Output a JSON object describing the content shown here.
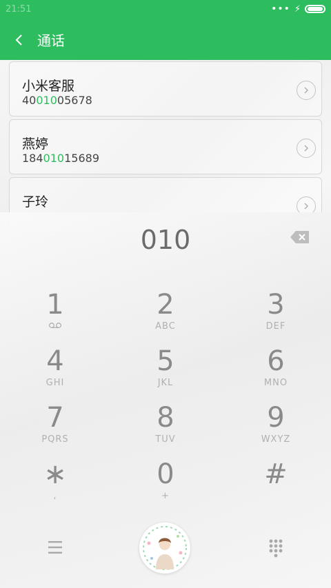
{
  "status_bar": {
    "time": "21:51",
    "dots": "•••",
    "bolt": "⚡"
  },
  "app_bar": {
    "title": "通话"
  },
  "contacts": [
    {
      "name": "小米客服",
      "number_prefix": "40",
      "number_match": "010",
      "number_suffix": "05678"
    },
    {
      "name": "燕婷",
      "number_prefix": "184",
      "number_match": "010",
      "number_suffix": "15689"
    },
    {
      "name": "子玲",
      "number_prefix": "",
      "number_match": "",
      "number_suffix": ""
    }
  ],
  "dialpad": {
    "typed": "010",
    "keys": [
      {
        "digit": "1",
        "sub": ""
      },
      {
        "digit": "2",
        "sub": "ABC"
      },
      {
        "digit": "3",
        "sub": "DEF"
      },
      {
        "digit": "4",
        "sub": "GHI"
      },
      {
        "digit": "5",
        "sub": "JKL"
      },
      {
        "digit": "6",
        "sub": "MNO"
      },
      {
        "digit": "7",
        "sub": "PQRS"
      },
      {
        "digit": "8",
        "sub": "TUV"
      },
      {
        "digit": "9",
        "sub": "WXYZ"
      },
      {
        "digit": "∗",
        "sub": ","
      },
      {
        "digit": "0",
        "sub": "+"
      },
      {
        "digit": "#",
        "sub": ""
      }
    ]
  },
  "icons": {
    "back": "chevron-left-icon",
    "backspace": "backspace-icon",
    "voicemail": "voicemail-icon",
    "menu": "menu-icon",
    "avatar": "avatar",
    "dialpad_toggle": "dialpad-grid-icon"
  },
  "colors": {
    "accent": "#2dbd5e"
  }
}
